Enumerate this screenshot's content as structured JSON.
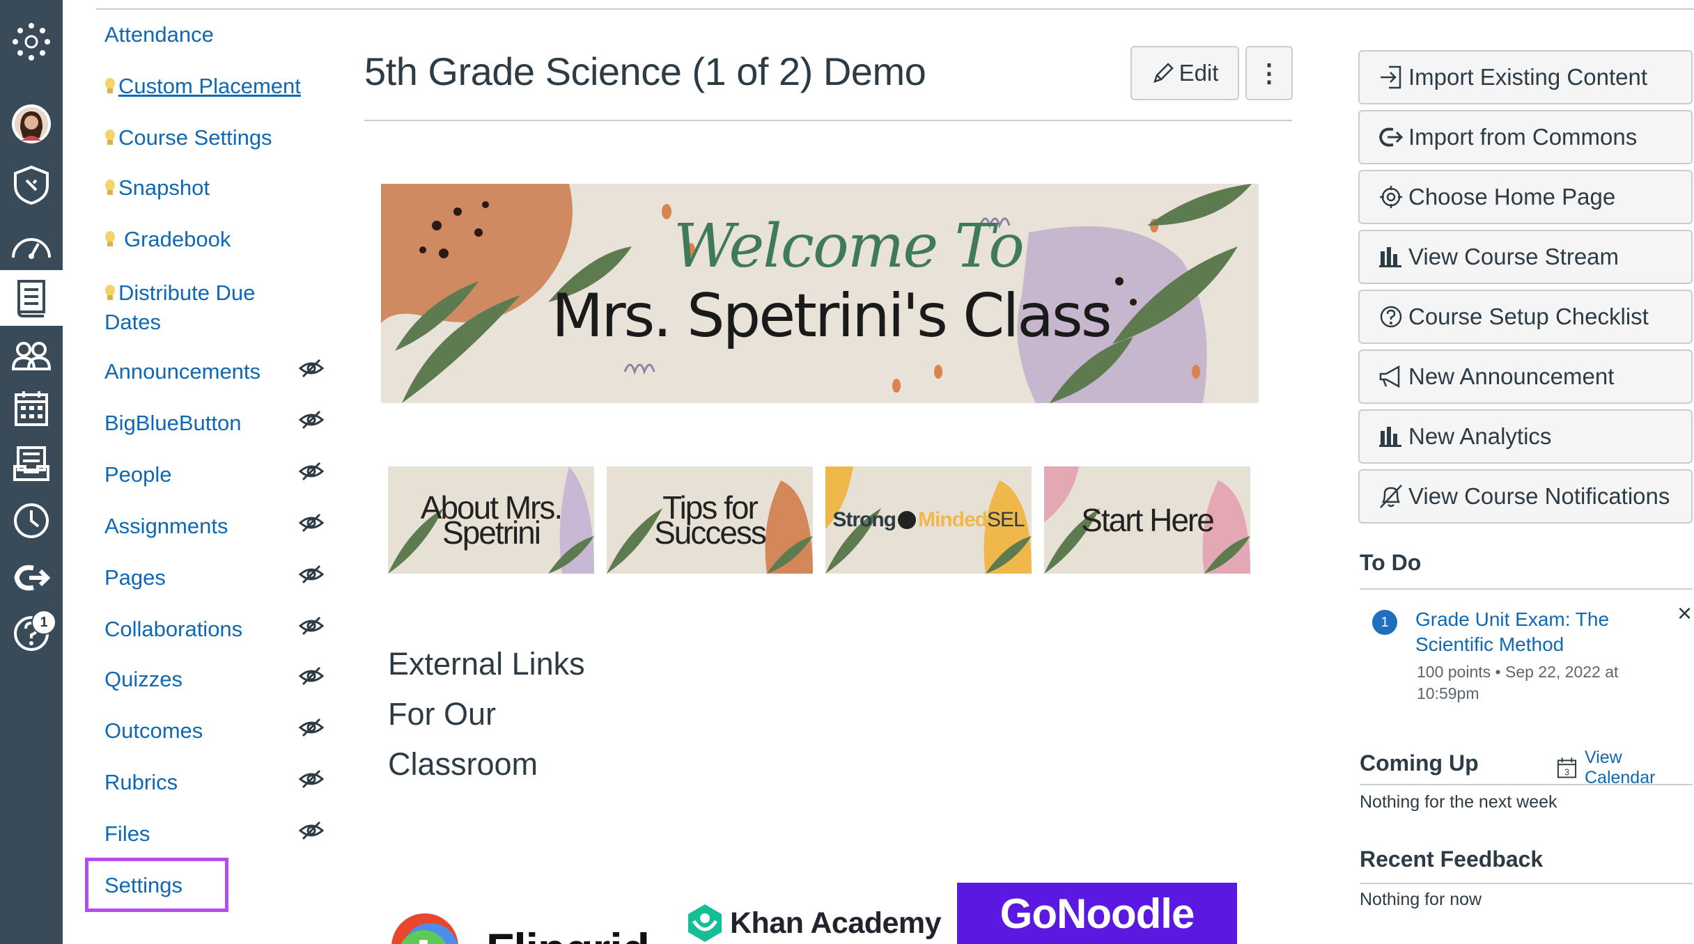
{
  "global_nav": {
    "help_badge": "1"
  },
  "course_nav": {
    "items": [
      {
        "label": "Attendance",
        "bulb": false,
        "hidden": false
      },
      {
        "label": "Custom Placement",
        "bulb": true,
        "hidden": false
      },
      {
        "label": "Course Settings",
        "bulb": true,
        "hidden": false
      },
      {
        "label": "Snapshot",
        "bulb": true,
        "hidden": false
      },
      {
        "label": "Gradebook",
        "bulb": true,
        "hidden": false
      },
      {
        "label": "Distribute Due",
        "label2": "Dates",
        "bulb": true,
        "hidden": false
      },
      {
        "label": "Announcements",
        "hidden": true
      },
      {
        "label": "BigBlueButton",
        "hidden": true
      },
      {
        "label": "People",
        "hidden": true
      },
      {
        "label": "Assignments",
        "hidden": true
      },
      {
        "label": "Pages",
        "hidden": true
      },
      {
        "label": "Collaborations",
        "hidden": true
      },
      {
        "label": "Quizzes",
        "hidden": true
      },
      {
        "label": "Outcomes",
        "hidden": true
      },
      {
        "label": "Rubrics",
        "hidden": true
      },
      {
        "label": "Files",
        "hidden": true
      },
      {
        "label": "Settings",
        "hidden": false,
        "highlighted": true
      }
    ]
  },
  "header": {
    "title": "5th Grade Science (1 of 2) Demo",
    "edit_label": "Edit",
    "more_label": "⋮"
  },
  "banner": {
    "script_text": "Welcome To",
    "main_text": "Mrs. Spetrini's Class"
  },
  "thumbnails": [
    {
      "text": "About Mrs. Spetrini"
    },
    {
      "text": "Tips for Success"
    },
    {
      "text_a": "Strong",
      "text_b": "Minded",
      "text_c": "SEL"
    },
    {
      "text": "Start Here"
    }
  ],
  "section": {
    "heading": "External Links For Our Classroom"
  },
  "logos": {
    "flipgrid": "Flipgrid",
    "khan": "Khan Academy",
    "gonoodle": "GoNoodle"
  },
  "sidebar": {
    "buttons": [
      {
        "label": "Import Existing Content",
        "icon": "import-icon"
      },
      {
        "label": "Import from Commons",
        "icon": "commons-icon"
      },
      {
        "label": "Choose Home Page",
        "icon": "target-icon"
      },
      {
        "label": "View Course Stream",
        "icon": "bar-chart-icon"
      },
      {
        "label": "Course Setup Checklist",
        "icon": "question-icon"
      },
      {
        "label": "New Announcement",
        "icon": "megaphone-icon"
      },
      {
        "label": "New Analytics",
        "icon": "bar-chart-icon"
      },
      {
        "label": "View Course Notifications",
        "icon": "bell-icon"
      }
    ],
    "todo": {
      "heading": "To Do",
      "item_number": "1",
      "item_title": "Grade Unit Exam: The Scientific Method",
      "item_title_l1": "Grade Unit Exam: The",
      "item_title_l2": "Scientific Method",
      "item_meta_l1": "100 points • Sep 22, 2022 at",
      "item_meta_l2": "10:59pm",
      "dismiss": "×"
    },
    "coming_up": {
      "heading": "Coming Up",
      "calendar_link": "View Calendar",
      "calendar_day": "3",
      "empty": "Nothing for the next week"
    },
    "recent_feedback": {
      "heading": "Recent Feedback",
      "empty": "Nothing for now"
    }
  },
  "colors": {
    "global_nav_bg": "#394b58",
    "link": "#0e68b3",
    "highlight_box": "#b54cf0",
    "gonoodle_bg": "#5b18e0"
  }
}
